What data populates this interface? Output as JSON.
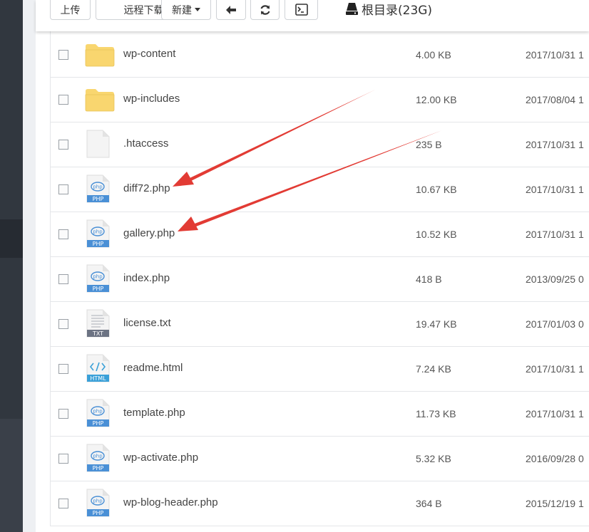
{
  "toolbar": {
    "upload_label": "上传",
    "remote_download_label": "远程下载",
    "new_label": "新建",
    "back_icon": "arrow-left-icon",
    "refresh_icon": "refresh-icon",
    "terminal_icon": "terminal-icon",
    "root_label": "根目录(23G)"
  },
  "colors": {
    "folder": "#f9d66f",
    "php_badge": "#4a90d6",
    "txt_badge": "#6c7383",
    "html_badge": "#3aa0d8",
    "annotation_arrow": "#e23b34"
  },
  "files": [
    {
      "name": "wp-content",
      "size": "4.00 KB",
      "date": "2017/10/31 1",
      "type": "folder"
    },
    {
      "name": "wp-includes",
      "size": "12.00 KB",
      "date": "2017/08/04 1",
      "type": "folder"
    },
    {
      "name": ".htaccess",
      "size": "235 B",
      "date": "2017/10/31 1",
      "type": "blank"
    },
    {
      "name": "diff72.php",
      "size": "10.67 KB",
      "date": "2017/10/31 1",
      "type": "php"
    },
    {
      "name": "gallery.php",
      "size": "10.52 KB",
      "date": "2017/10/31 1",
      "type": "php"
    },
    {
      "name": "index.php",
      "size": "418 B",
      "date": "2013/09/25 0",
      "type": "php"
    },
    {
      "name": "license.txt",
      "size": "19.47 KB",
      "date": "2017/01/03 0",
      "type": "txt"
    },
    {
      "name": "readme.html",
      "size": "7.24 KB",
      "date": "2017/10/31 1",
      "type": "html"
    },
    {
      "name": "template.php",
      "size": "11.73 KB",
      "date": "2017/10/31 1",
      "type": "php"
    },
    {
      "name": "wp-activate.php",
      "size": "5.32 KB",
      "date": "2016/09/28 0",
      "type": "php"
    },
    {
      "name": "wp-blog-header.php",
      "size": "364 B",
      "date": "2015/12/19 1",
      "type": "php"
    }
  ],
  "badges": {
    "php": "PHP",
    "txt": "TXT",
    "html": "HTML"
  }
}
